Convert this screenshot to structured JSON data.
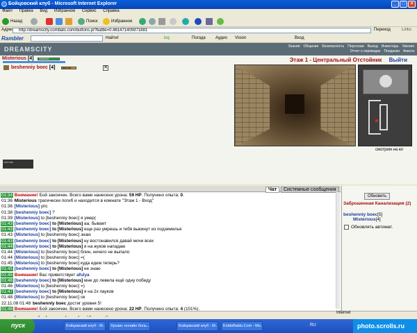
{
  "window": {
    "title": "Бойцовский клуб - Microsoft Internet Explorer"
  },
  "menu": [
    "Файл",
    "Правка",
    "Вид",
    "Избранное",
    "Сервис",
    "Справка"
  ],
  "toolbar": {
    "back": "Назад",
    "search": "Поиск",
    "favorites": "Избранное"
  },
  "address": {
    "label": "Адрес:",
    "url": "http://dreamscity.combats.com/buttons.pl?battle=0.461471405971881",
    "go": "Переход",
    "links": "Links"
  },
  "rambler": {
    "brand": "Rambler",
    "find": "Найти!",
    "icq": "icq",
    "weather": "Погода",
    "audio": "Аудио",
    "vision": "Vision",
    "login": "Вход"
  },
  "game": {
    "logo": "DREAMSCITY",
    "nav": [
      "Знания",
      "Общение",
      "Безопасность",
      "Персонаж",
      "Выход",
      "Инвентарь",
      "Умения",
      "Отчет о переводах",
      "Поединки",
      "Анкета"
    ],
    "player1": {
      "name": "Misterious",
      "level": "[4]",
      "hp": "132/132",
      "hp_fraction": 1.0
    },
    "player2": {
      "name": "beshenniy boec",
      "level": "[4]",
      "hp": "54/126",
      "hp_fraction": 0.43
    },
    "location": "Этаж 1 - Центральный Отстойник",
    "exit": "Выйти",
    "facing": "смотрим на юг",
    "counter": "счетчик"
  },
  "chat": {
    "tabs": [
      "Чат",
      "Системные сообщения"
    ],
    "lines": [
      {
        "t": "01:34",
        "hl": true,
        "parts": [
          {
            "c": "warn",
            "s": "Внимание!"
          },
          {
            "c": "",
            "s": " Бой закончен. Всего вами нанесено урона: "
          },
          {
            "c": "b",
            "s": "59 HP"
          },
          {
            "c": "",
            "s": ". Получено опыта: "
          },
          {
            "c": "b",
            "s": "0"
          },
          {
            "c": "",
            "s": "."
          }
        ]
      },
      {
        "t": "01:36",
        "hl": false,
        "parts": [
          {
            "c": "b",
            "s": "Misterious"
          },
          {
            "c": "",
            "s": " трагически погиб и находится в комнате \"Этаж 1 - Вход\""
          }
        ]
      },
      {
        "t": "01:36",
        "hl": false,
        "parts": [
          {
            "c": "nick",
            "s": "[Misterious]"
          },
          {
            "c": "",
            "s": " упс"
          }
        ]
      },
      {
        "t": "01:38",
        "hl": false,
        "parts": [
          {
            "c": "nick",
            "s": "[beshenniy boec]"
          },
          {
            "c": "",
            "s": " ?"
          }
        ]
      },
      {
        "t": "01:39",
        "hl": false,
        "parts": [
          {
            "c": "nick",
            "s": "[Misterious]"
          },
          {
            "c": "",
            "s": " to [beshenniy boec] я умер("
          }
        ]
      },
      {
        "t": "01:43",
        "hl": true,
        "parts": [
          {
            "c": "nick",
            "s": "[beshenniy boec]"
          },
          {
            "c": "b",
            "s": " to [Misterious]"
          },
          {
            "c": "",
            "s": " аа, бывает"
          }
        ]
      },
      {
        "t": "01:43",
        "hl": true,
        "parts": [
          {
            "c": "nick",
            "s": "[beshenniy boec]"
          },
          {
            "c": "b",
            "s": " to [Misterious]"
          },
          {
            "c": "",
            "s": " еще раз умрешь и тебя выкинут из подземелья"
          }
        ]
      },
      {
        "t": "01:43",
        "hl": false,
        "parts": [
          {
            "c": "nick",
            "s": "[Misterious]"
          },
          {
            "c": "",
            "s": " to [beshenniy boec] знаю"
          }
        ]
      },
      {
        "t": "01:43",
        "hl": true,
        "parts": [
          {
            "c": "nick",
            "s": "[beshenniy boec]"
          },
          {
            "c": "b",
            "s": " to [Misterious]"
          },
          {
            "c": "",
            "s": " ну востонавился давай мочи всех"
          }
        ]
      },
      {
        "t": "01:44",
        "hl": true,
        "parts": [
          {
            "c": "nick",
            "s": "[beshenniy boec]"
          },
          {
            "c": "b",
            "s": " to [Misterious]"
          },
          {
            "c": "",
            "s": " я на жуков нападаю"
          }
        ]
      },
      {
        "t": "01:44",
        "hl": false,
        "parts": [
          {
            "c": "nick",
            "s": "[Misterious]"
          },
          {
            "c": "",
            "s": " to [beshenniy boec] блин, ничего не выпало"
          }
        ]
      },
      {
        "t": "01:44",
        "hl": false,
        "parts": [
          {
            "c": "nick",
            "s": "[Misterious]"
          },
          {
            "c": "",
            "s": " to [beshenniy boec] =("
          }
        ]
      },
      {
        "t": "01:45",
        "hl": false,
        "parts": [
          {
            "c": "nick",
            "s": "[Misterious]"
          },
          {
            "c": "",
            "s": " to [beshenniy boec] куда идем теперь?"
          }
        ]
      },
      {
        "t": "01:45",
        "hl": true,
        "parts": [
          {
            "c": "nick",
            "s": "[beshenniy boec]"
          },
          {
            "c": "b",
            "s": " to [Misterious]"
          },
          {
            "c": "",
            "s": " не знаю"
          }
        ]
      },
      {
        "t": "01:45",
        "hl": true,
        "parts": [
          {
            "c": "warn",
            "s": "Внимание!"
          },
          {
            "c": "",
            "s": " Вас приветствует "
          },
          {
            "c": "nick",
            "s": "afulya"
          }
        ]
      },
      {
        "t": "01:46",
        "hl": true,
        "parts": [
          {
            "c": "nick",
            "s": "[beshenniy boec]"
          },
          {
            "c": "b",
            "s": " to [Misterious]"
          },
          {
            "c": "",
            "s": " мне до левела ещё одну победу"
          }
        ]
      },
      {
        "t": "01:46",
        "hl": false,
        "parts": [
          {
            "c": "nick",
            "s": "[Misterious]"
          },
          {
            "c": "",
            "s": " to [beshenniy boec] =)"
          }
        ]
      },
      {
        "t": "01:47",
        "hl": true,
        "parts": [
          {
            "c": "nick",
            "s": "[beshenniy boec]"
          },
          {
            "c": "b",
            "s": " to [Misterious]"
          },
          {
            "c": "",
            "s": " я на 2х пауков"
          }
        ]
      },
      {
        "t": "01:48",
        "hl": false,
        "parts": [
          {
            "c": "nick",
            "s": "[Misterious]"
          },
          {
            "c": "",
            "s": " to [beshenniy boec] ок"
          }
        ]
      },
      {
        "t": "22.11.08 01:48",
        "hl": false,
        "parts": [
          {
            "c": "b",
            "s": "beshenniy boec"
          },
          {
            "c": "",
            "s": " достиг уровня 5!"
          }
        ]
      },
      {
        "t": "01:48",
        "hl": true,
        "parts": [
          {
            "c": "warn",
            "s": "Внимание!"
          },
          {
            "c": "",
            "s": " Бой закончен. Всего вами нанесено урона: "
          },
          {
            "c": "b",
            "s": "22 HP"
          },
          {
            "c": "",
            "s": ". Получено опыта: "
          },
          {
            "c": "b",
            "s": "4"
          },
          {
            "c": "",
            "s": " (101%)."
          }
        ]
      },
      {
        "t": "01:49",
        "hl": false,
        "parts": [
          {
            "c": "nick",
            "s": "[Misterious]"
          },
          {
            "c": "",
            "s": " to [beshenniy boec] поздравляю))"
          }
        ]
      }
    ]
  },
  "right": {
    "refresh": "Обновить",
    "room": "Заброшенная Канализация",
    "count": "(2)",
    "users": [
      {
        "name": "beshenniy boec",
        "level": "[5]"
      },
      {
        "name": "Misterious",
        "level": "[4]"
      }
    ],
    "auto_update": "Обновлять автомат."
  },
  "status": {
    "done": "Internet"
  },
  "taskbar": {
    "start": "пуск",
    "tasks": [
      "Бойцовский клуб - М...",
      "Xpuзис онлайн боль...",
      "Бойцовский клуб - М...",
      "KoldoBablo.Com - Mo..."
    ],
    "lang": "RU",
    "watermark": "photo.scrolls.ru"
  }
}
